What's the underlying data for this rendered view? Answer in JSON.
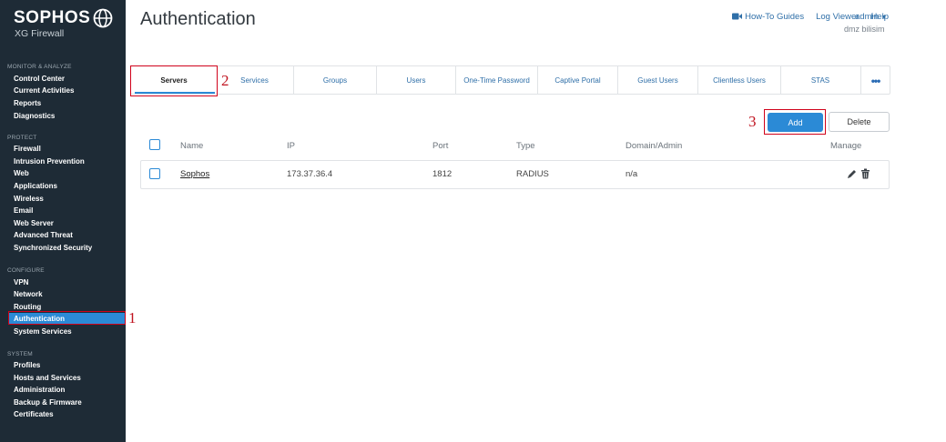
{
  "brand": {
    "name": "SOPHOS",
    "product": "XG Firewall"
  },
  "sidebar": {
    "sections": [
      {
        "label": "MONITOR & ANALYZE"
      },
      {
        "label": "PROTECT"
      },
      {
        "label": "CONFIGURE"
      },
      {
        "label": "SYSTEM"
      }
    ],
    "items": [
      "Control Center",
      "Current Activities",
      "Reports",
      "Diagnostics",
      "Firewall",
      "Intrusion Prevention",
      "Web",
      "Applications",
      "Wireless",
      "Email",
      "Web Server",
      "Advanced Threat",
      "Synchronized Security",
      "VPN",
      "Network",
      "Routing",
      "Authentication",
      "System Services",
      "Profiles",
      "Hosts and Services",
      "Administration",
      "Backup & Firmware",
      "Certificates"
    ],
    "active_item": "Authentication"
  },
  "header": {
    "title": "Authentication",
    "links": [
      "How-To Guides",
      "Log Viewer",
      "Help"
    ],
    "user": "admin",
    "organization": "dmz bilisim"
  },
  "tabs": [
    "Servers",
    "Services",
    "Groups",
    "Users",
    "One-Time Password",
    "Captive Portal",
    "Guest Users",
    "Clientless Users",
    "STAS"
  ],
  "active_tab": "Servers",
  "actions": {
    "add": "Add",
    "delete": "Delete"
  },
  "table": {
    "columns": [
      "Name",
      "IP",
      "Port",
      "Type",
      "Domain/Admin",
      "Manage"
    ],
    "rows": [
      {
        "name": "Sophos",
        "ip": "173.37.36.4",
        "port": "1812",
        "type": "RADIUS",
        "domain": "n/a"
      }
    ]
  },
  "annotations": {
    "step1": "1",
    "step2": "2",
    "step3": "3"
  },
  "colors": {
    "sidebar_bg": "#1e2b36",
    "accent": "#2b8ad6",
    "annotation": "#d0021b",
    "link": "#2f6fa8"
  },
  "icons": [
    "globe-icon",
    "video-camera-icon",
    "chevron-down-icon",
    "more-icon",
    "pencil-icon",
    "trash-icon"
  ]
}
